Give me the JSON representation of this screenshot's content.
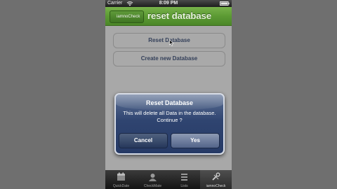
{
  "status_bar": {
    "carrier": "Carrier",
    "time": "8:09 PM"
  },
  "nav_bar": {
    "back_label": "iamnoCheck",
    "title": "reset database"
  },
  "buttons": {
    "reset_database": "Reset Database",
    "create_database": "Create new Database"
  },
  "alert": {
    "title": "Reset Database",
    "message": "This will delete all Data in the database. Continue ?",
    "cancel_label": "Cancel",
    "confirm_label": "Yes"
  },
  "tab_bar": {
    "items": [
      {
        "label": "QuickDate",
        "icon": "calendar-icon"
      },
      {
        "label": "CheckMate",
        "icon": "checkmate-icon"
      },
      {
        "label": "Lists",
        "icon": "lists-icon"
      },
      {
        "label": "iamnoCheck",
        "icon": "tools-icon"
      }
    ]
  },
  "colors": {
    "nav_green": "#5c9a34",
    "alert_blue": "#2f4470",
    "button_text": "#34405a"
  }
}
